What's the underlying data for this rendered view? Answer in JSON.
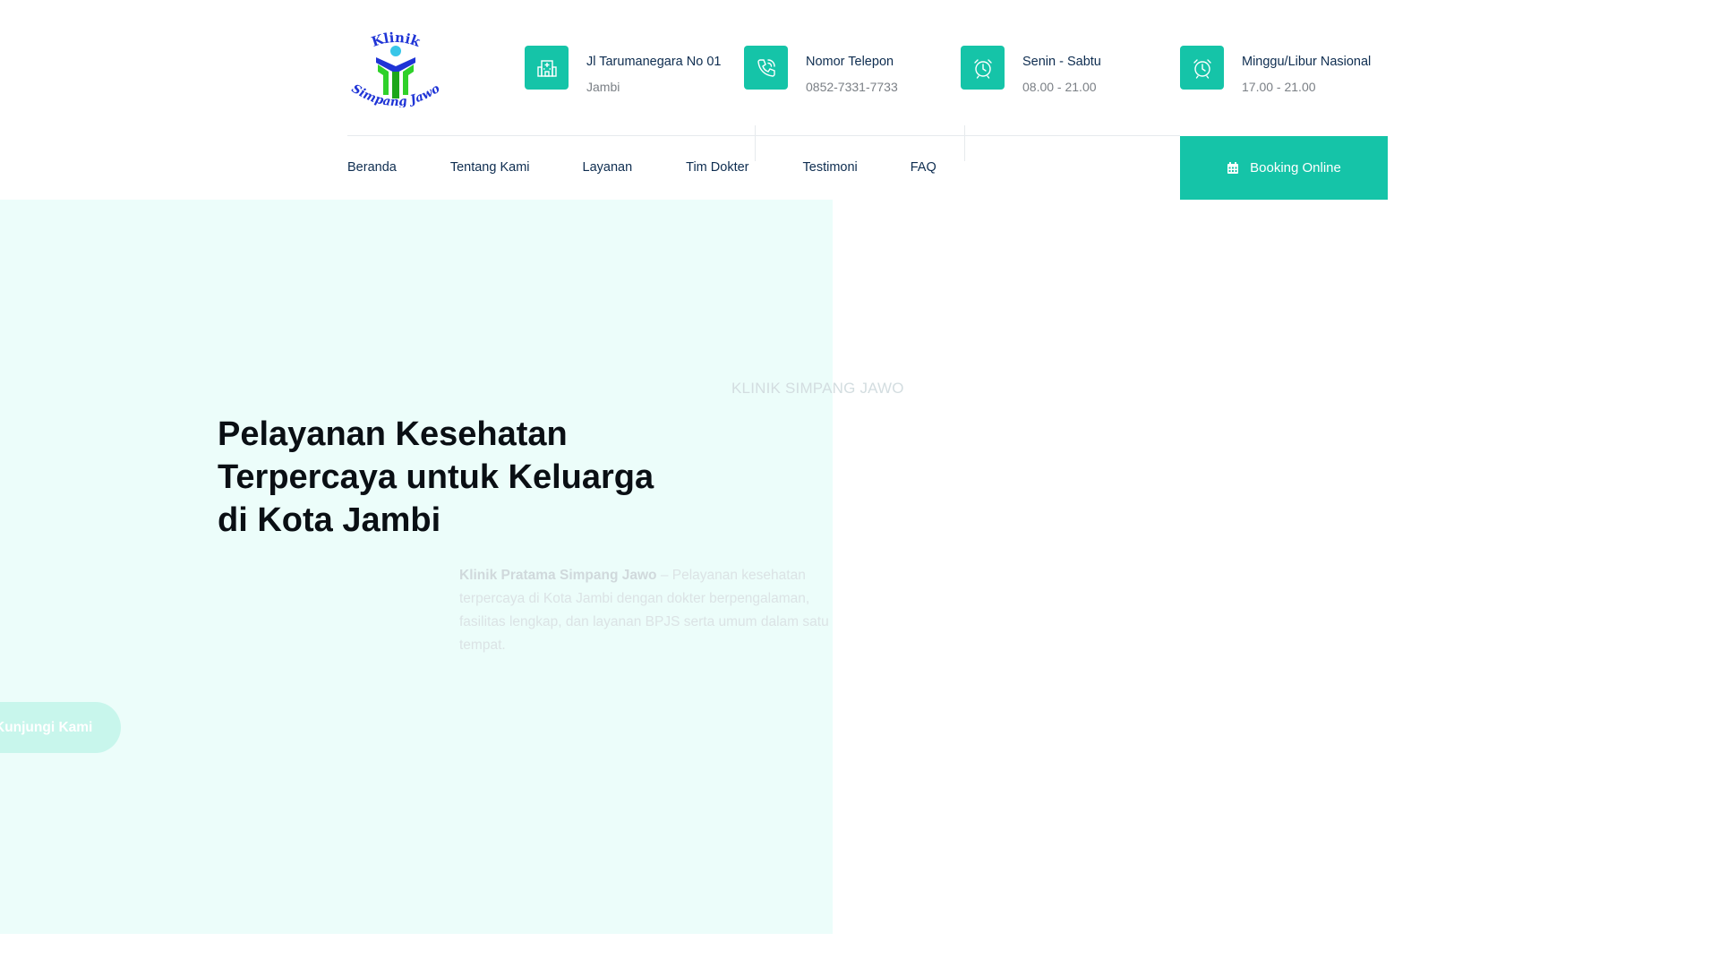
{
  "header": {
    "logo_text_top": "Klinik",
    "logo_text_bottom": "Simpang Jawo",
    "info": [
      {
        "icon": "hospital-icon",
        "title": "Jl Tarumanegara No 01",
        "subtitle": "Jambi"
      },
      {
        "icon": "phone-icon",
        "title": "Nomor Telepon",
        "subtitle": "0852-7331-7733"
      },
      {
        "icon": "alarm-clock-icon",
        "title": "Senin - Sabtu",
        "subtitle": "08.00 - 21.00"
      },
      {
        "icon": "alarm-clock-icon",
        "title": "Minggu/Libur Nasional",
        "subtitle": "17.00 - 21.00"
      }
    ]
  },
  "nav": {
    "items": [
      "Beranda",
      "Tentang Kami",
      "Layanan",
      "Tim Dokter",
      "Testimoni",
      "FAQ"
    ],
    "booking_label": "Booking Online"
  },
  "hero": {
    "eyebrow": "KLINIK SIMPANG JAWO",
    "title_line1": "Pelayanan Kesehatan",
    "title_line2": "Terpercaya untuk Keluarga",
    "title_line3": "di Kota Jambi",
    "desc_strong": "Klinik Pratama Simpang Jawo",
    "desc_rest": " – Pelayanan kesehatan terpercaya di Kota Jambi dengan dokter berpengalaman, fasilitas lengkap, dan layanan BPJS serta umum dalam satu tempat.",
    "cta_label": "Kunjungi Kami"
  },
  "colors": {
    "accent": "#15c4a8",
    "hero_bg": "#ecfdfa",
    "nav_text": "#0e2d50"
  }
}
